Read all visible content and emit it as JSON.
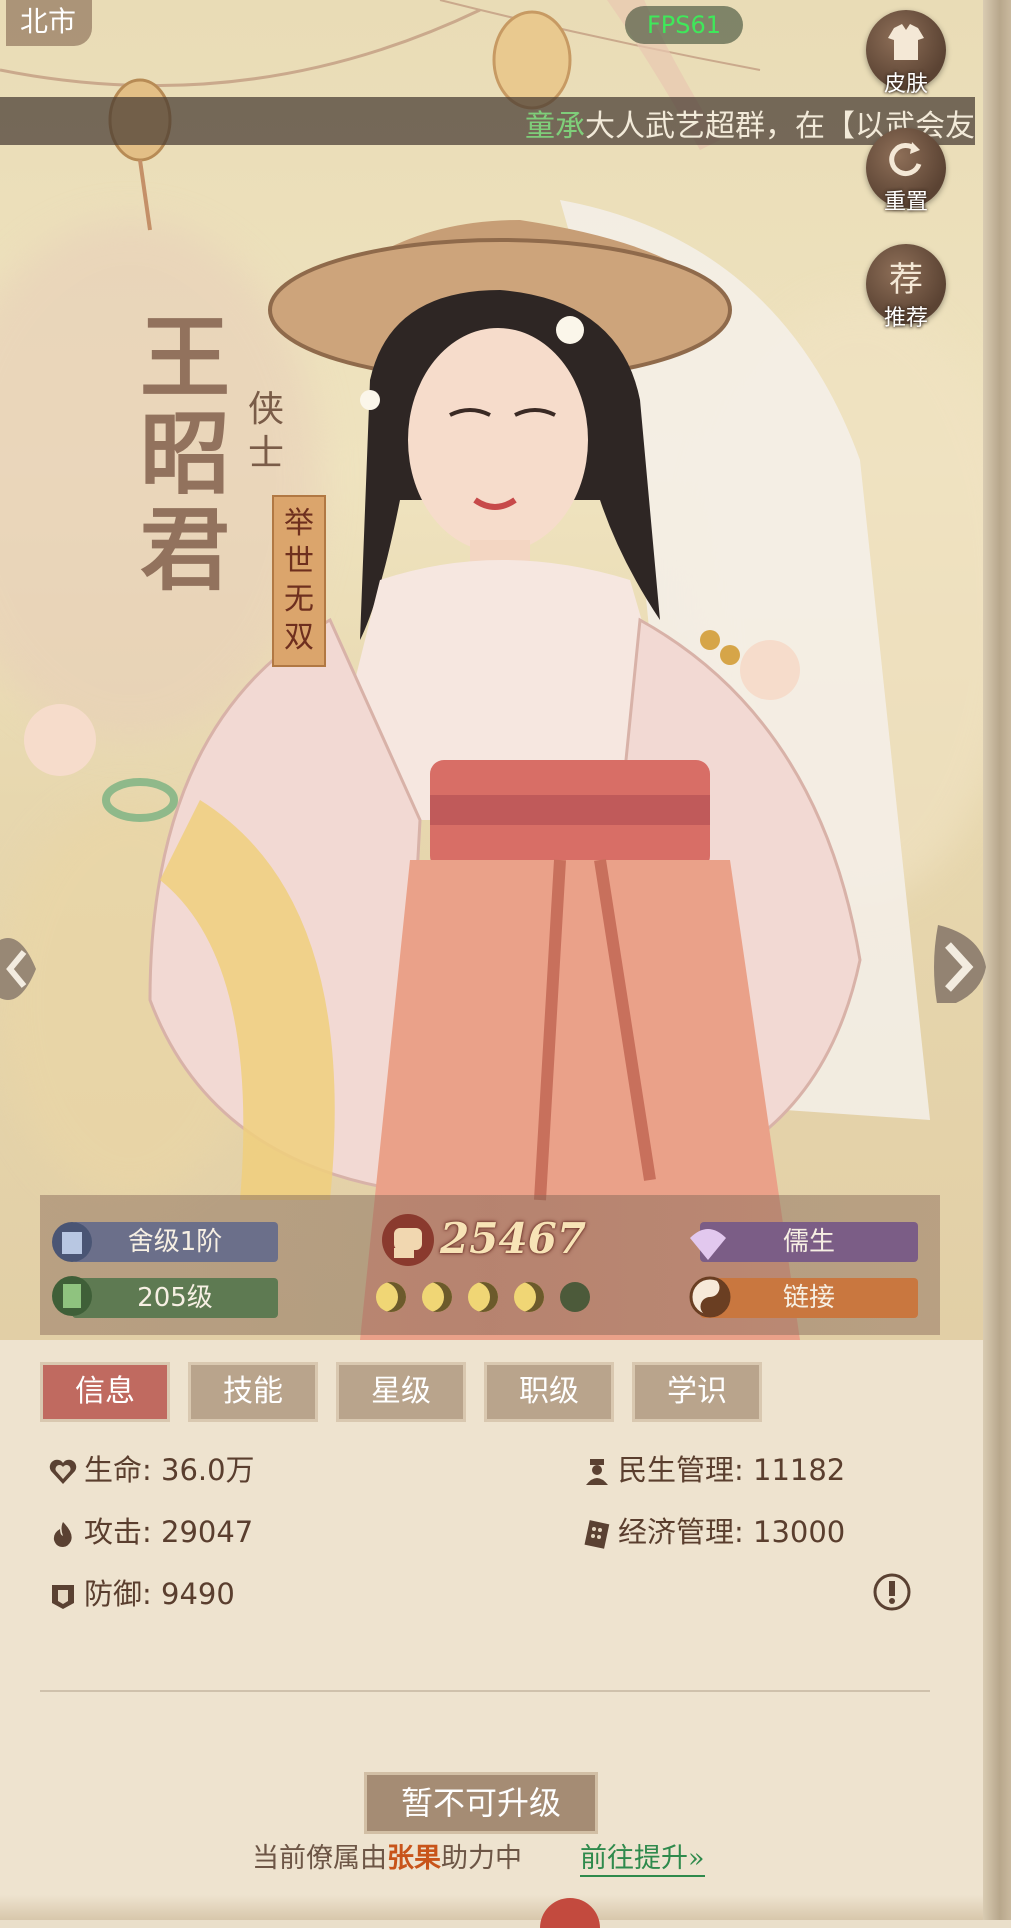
{
  "top": {
    "location": "北市",
    "fps": "FPS61"
  },
  "ticker": {
    "highlight": "童承",
    "text": "大人武艺超群，在【以武会友"
  },
  "side_buttons": [
    {
      "label": "皮肤",
      "icon": "robe-icon"
    },
    {
      "label": "重置",
      "icon": "reset-icon"
    },
    {
      "label": "推荐",
      "glyph": "荐",
      "icon": "recommend-icon"
    }
  ],
  "character": {
    "name": "王昭君",
    "class": "侠士",
    "title": "举世无双"
  },
  "badges": {
    "residence_level": "舍级1阶",
    "level": "205级",
    "power": "25467",
    "profession": "儒生",
    "link": "链接",
    "stars": {
      "filled": 4,
      "total": 5
    }
  },
  "tabs": [
    "信息",
    "技能",
    "星级",
    "职级",
    "学识"
  ],
  "active_tab": 0,
  "stats": {
    "hp": "生命: 36.0万",
    "attack": "攻击: 29047",
    "defense": "防御: 9490",
    "livelihood": "民生管理: 11182",
    "economy": "经济管理: 13000"
  },
  "upgrade": {
    "button": "暂不可升级",
    "assist_prefix": "当前僚属由",
    "assist_name": "张果",
    "assist_suffix": "助力中",
    "goto": "前往提升»"
  },
  "colors": {
    "active_tab": "#c06a60",
    "tab": "#b9a48c",
    "residence_badge": "#6b6f8a",
    "level_badge": "#5e7a52",
    "profession_badge": "#7b5d86",
    "link_badge": "#c9773f",
    "assist_name": "#c8541a",
    "goto": "#2f8a4c",
    "fps": "#3fe85a"
  }
}
